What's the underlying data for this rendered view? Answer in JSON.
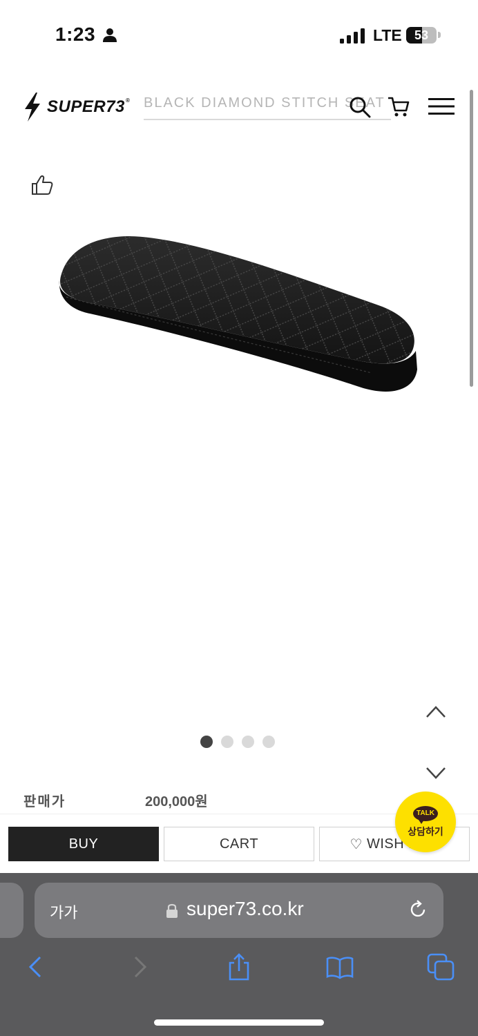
{
  "status_bar": {
    "time": "1:23",
    "network": "LTE",
    "battery_level": 53,
    "battery_text": "53"
  },
  "header": {
    "logo_text": "SUPER73",
    "logo_reg": "®",
    "search_text": "BLACK DIAMOND STITCH SEAT"
  },
  "product": {
    "image_icon": "diamond-stitch-seat",
    "pager": {
      "total": 4,
      "current": 1
    },
    "price_label": "판매가",
    "price_value": "200,000원"
  },
  "actions": {
    "buy_label": "BUY",
    "cart_label": "CART",
    "wish_label": "WISH LIST",
    "wish_icon": "♡"
  },
  "talk_button": {
    "badge": "TALK",
    "label": "상담하기",
    "color": "#fde000"
  },
  "browser": {
    "aa_label": "가가",
    "url": "super73.co.kr"
  },
  "colors": {
    "buy_bg": "#222222",
    "browser_bg": "#5a5a5c",
    "link_blue": "#4a8ff7"
  }
}
